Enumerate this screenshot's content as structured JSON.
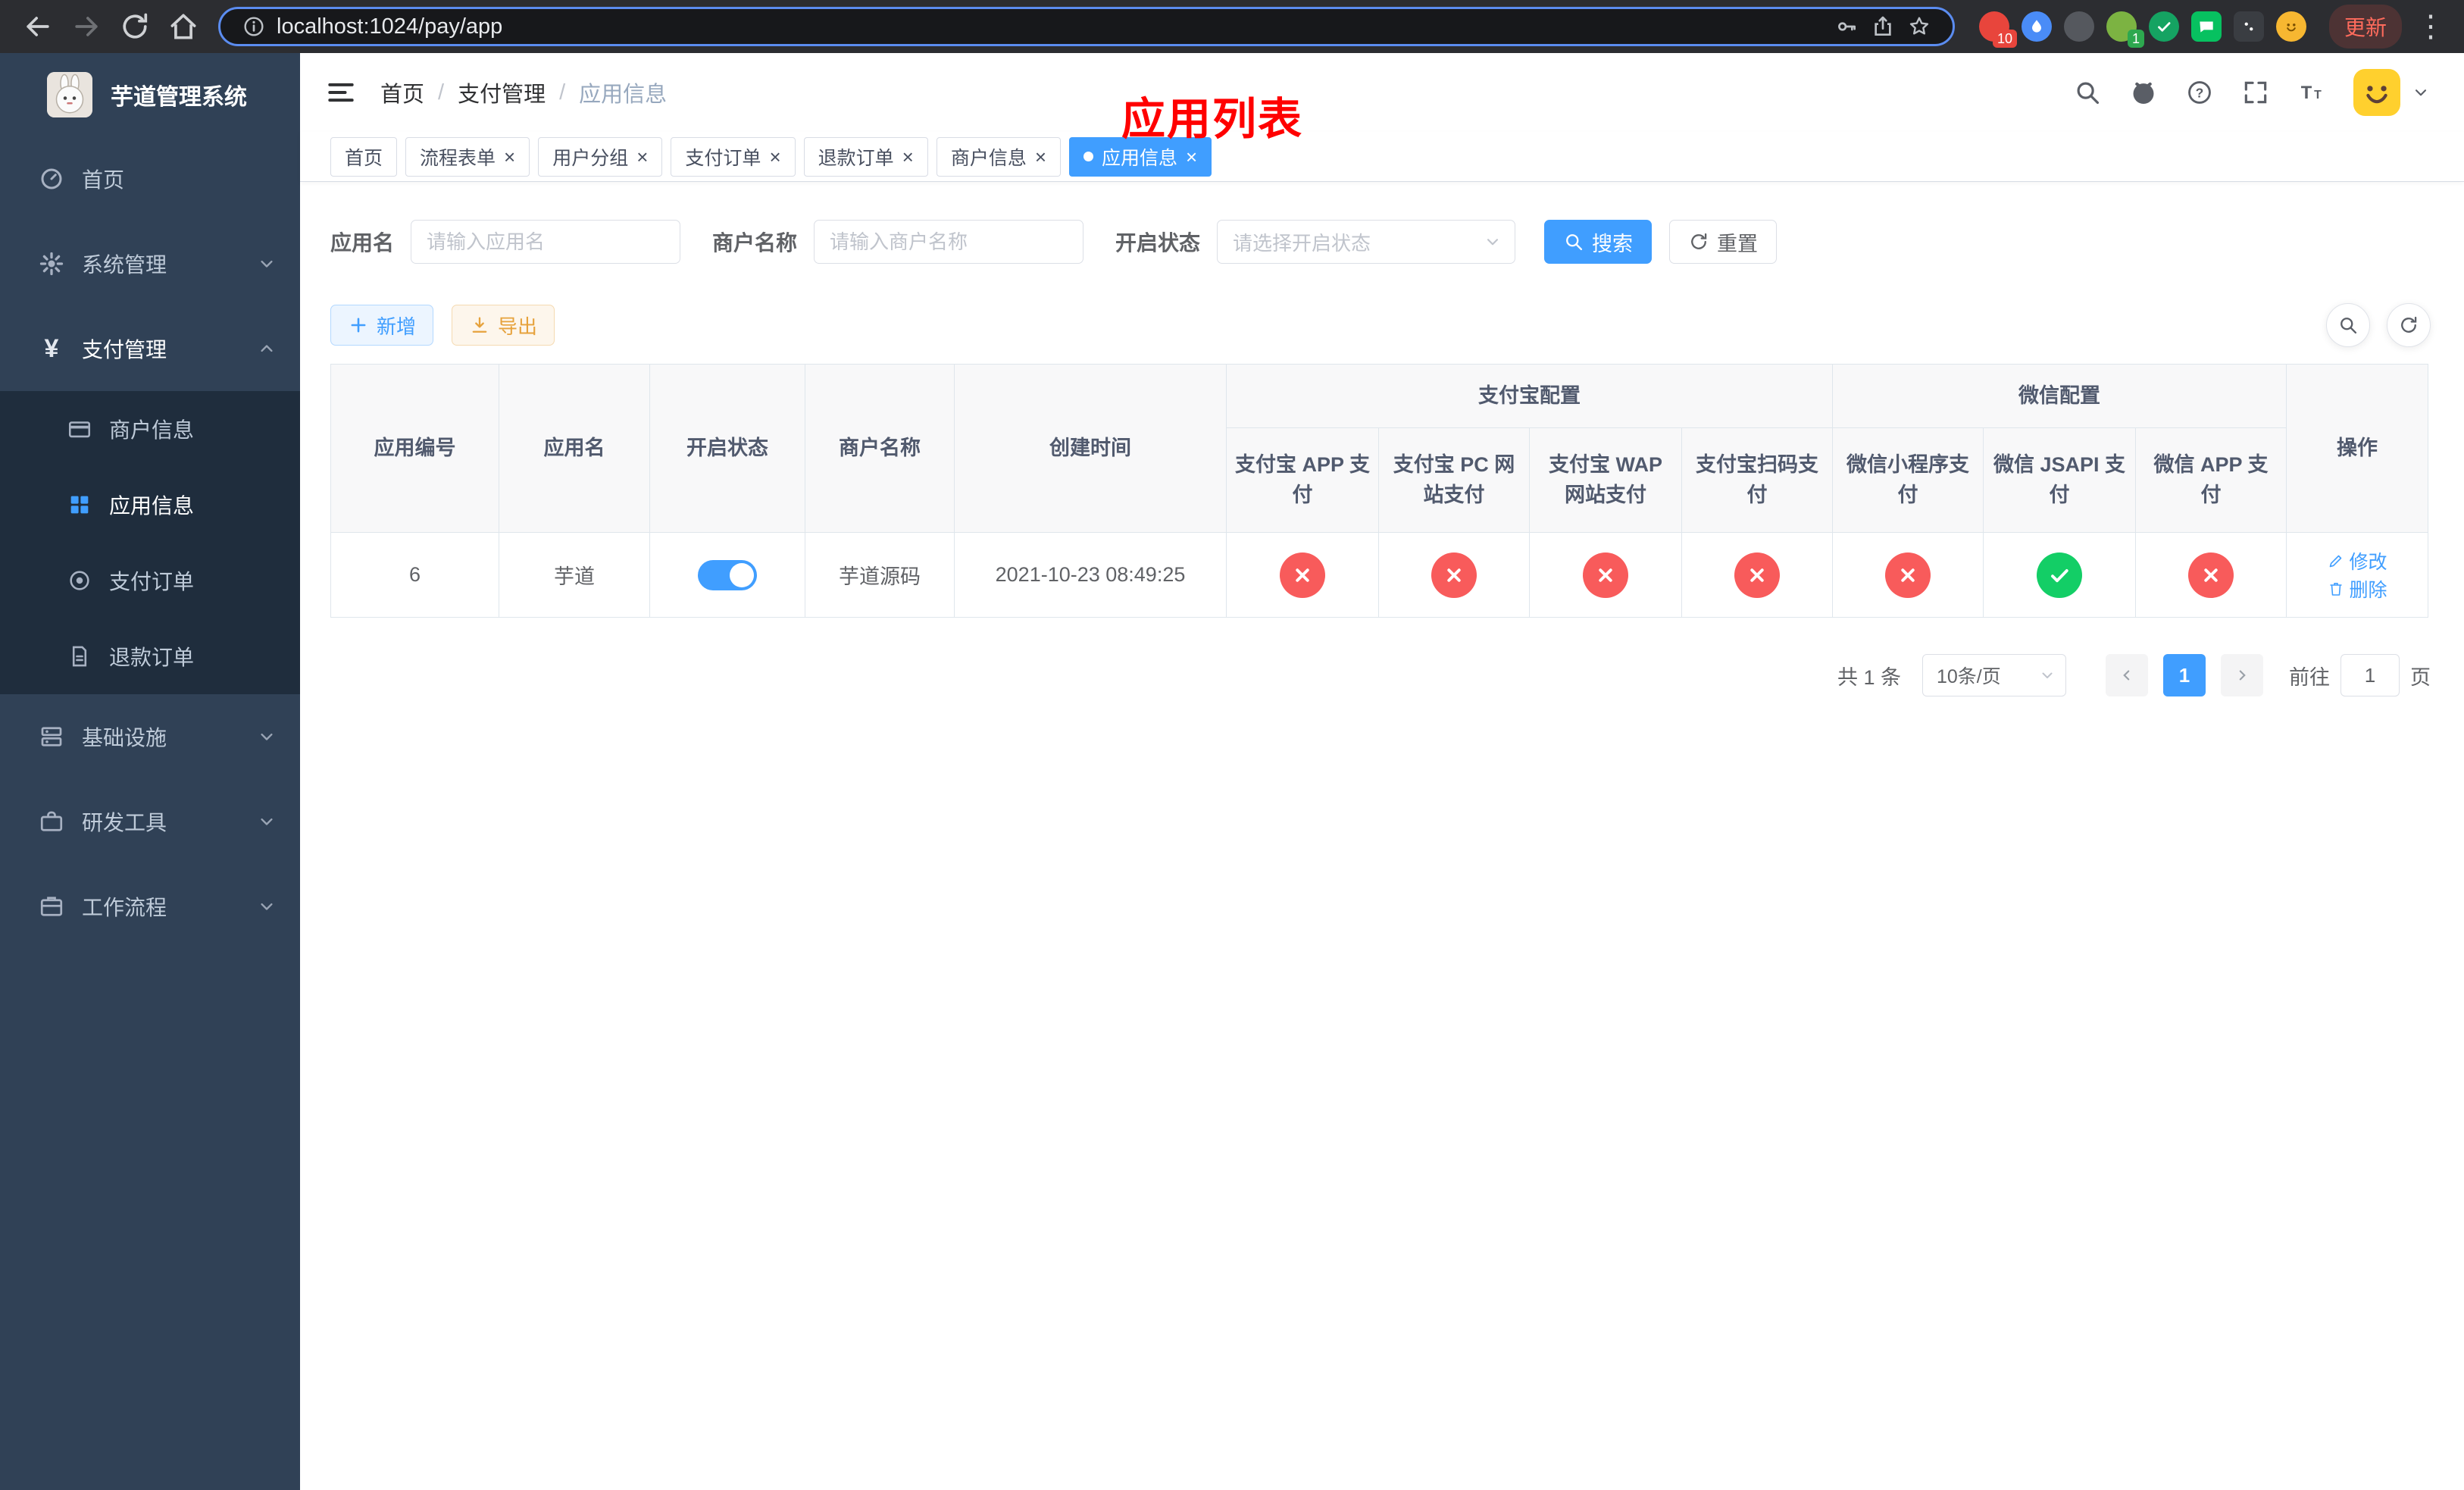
{
  "browser": {
    "url": "localhost:1024/pay/app",
    "update_label": "更新",
    "extensions": [
      {
        "name": "extension-red-icon",
        "color": "#e8453c",
        "badge": "10",
        "badge_color": "#e8453c"
      },
      {
        "name": "extension-blue-drop-icon",
        "color": "#4a8cf7"
      },
      {
        "name": "extension-dark-icon",
        "color": "#55585e"
      },
      {
        "name": "extension-colorful-icon",
        "color": "#7cb342",
        "badge": "1",
        "badge_color": "#2da84f"
      },
      {
        "name": "extension-green-check-icon",
        "color": "#15a362",
        "glyph": "check"
      },
      {
        "name": "extension-green-chat-icon",
        "color": "#07c160",
        "shape": "square"
      },
      {
        "name": "extension-black-pin-icon",
        "color": "#3a3d42",
        "shape": "square"
      },
      {
        "name": "extension-emoji-face-icon",
        "color": "#f7b731",
        "glyph": "face"
      }
    ]
  },
  "sidebar": {
    "logo_title": "芋道管理系统",
    "menu": [
      {
        "key": "home",
        "label": "首页",
        "icon": "dashboard-icon"
      },
      {
        "key": "system",
        "label": "系统管理",
        "icon": "gear-icon",
        "chevron": "down"
      },
      {
        "key": "payment",
        "label": "支付管理",
        "icon": "yen-icon",
        "chevron": "up",
        "expanded": true,
        "children": [
          {
            "key": "merchant-info",
            "label": "商户信息",
            "icon": "card-icon"
          },
          {
            "key": "app-info",
            "label": "应用信息",
            "icon": "grid-icon",
            "active": true
          },
          {
            "key": "pay-order",
            "label": "支付订单",
            "icon": "order-icon"
          },
          {
            "key": "refund-order",
            "label": "退款订单",
            "icon": "refund-icon"
          }
        ]
      },
      {
        "key": "infra",
        "label": "基础设施",
        "icon": "infra-icon",
        "chevron": "down"
      },
      {
        "key": "dev-tools",
        "label": "研发工具",
        "icon": "tools-icon",
        "chevron": "down"
      },
      {
        "key": "workflow",
        "label": "工作流程",
        "icon": "workflow-icon",
        "chevron": "down"
      }
    ]
  },
  "header": {
    "breadcrumb": [
      "首页",
      "支付管理",
      "应用信息"
    ],
    "breadcrumb_separator": "/",
    "overlay_title": "应用列表"
  },
  "tabs": [
    {
      "label": "首页",
      "closable": false,
      "active": false
    },
    {
      "label": "流程表单",
      "closable": true,
      "active": false
    },
    {
      "label": "用户分组",
      "closable": true,
      "active": false
    },
    {
      "label": "支付订单",
      "closable": true,
      "active": false
    },
    {
      "label": "退款订单",
      "closable": true,
      "active": false
    },
    {
      "label": "商户信息",
      "closable": true,
      "active": false
    },
    {
      "label": "应用信息",
      "closable": true,
      "active": true
    }
  ],
  "filters": {
    "app_name_label": "应用名",
    "app_name_placeholder": "请输入应用名",
    "merchant_label": "商户名称",
    "merchant_placeholder": "请输入商户名称",
    "status_label": "开启状态",
    "status_placeholder": "请选择开启状态",
    "search_label": "搜索",
    "reset_label": "重置"
  },
  "toolbar": {
    "add_label": "新增",
    "export_label": "导出"
  },
  "table": {
    "plain_columns": [
      "应用编号",
      "应用名",
      "开启状态",
      "商户名称",
      "创建时间"
    ],
    "group_headers": {
      "alipay": "支付宝配置",
      "wechat": "微信配置"
    },
    "alipay_columns": [
      "支付宝 APP 支付",
      "支付宝 PC 网站支付",
      "支付宝 WAP 网站支付",
      "支付宝扫码支付"
    ],
    "wechat_columns": [
      "微信小程序支付",
      "微信 JSAPI 支付",
      "微信 APP 支付"
    ],
    "action_column": "操作",
    "rows": [
      {
        "id": "6",
        "name": "芋道",
        "enabled": true,
        "merchant": "芋道源码",
        "created": "2021-10-23 08:49:25",
        "channels": [
          false,
          false,
          false,
          false,
          false,
          true,
          false
        ],
        "actions": [
          {
            "label": "修改",
            "icon": "edit-icon"
          },
          {
            "label": "删除",
            "icon": "delete-icon"
          }
        ]
      }
    ]
  },
  "pagination": {
    "total_text": "共 1 条",
    "page_size": "10条/页",
    "current_page": "1",
    "goto_prefix": "前往",
    "goto_value": "1",
    "goto_suffix": "页"
  },
  "colors": {
    "primary": "#409eff",
    "success": "#13ce66",
    "danger": "#f85b5b",
    "warning": "#e6a23c",
    "overlay_title": "#ff0000"
  }
}
